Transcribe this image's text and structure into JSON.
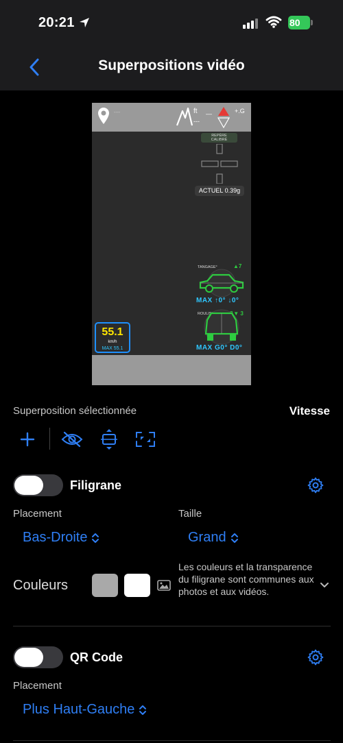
{
  "status_bar": {
    "time": "20:21",
    "battery": "80"
  },
  "nav": {
    "title": "Superpositions vidéo"
  },
  "preview": {
    "calibrated_label_line1": "REPÈRE",
    "calibrated_label_line2": "CALIBRÉ",
    "current_g": "ACTUEL 0.39g",
    "altitude_unit": "ft",
    "altitude_value": "---",
    "heading_value": "—",
    "g_label": "+.G",
    "location_text": "----",
    "pitch_label": "TANGAGE°",
    "pitch_value": "▲7",
    "pitch_max": "MAX ↑0° ↓0°",
    "roll_label": "ROULIS°",
    "roll_value": "G▼ 3",
    "roll_max": "MAX G0° D0°",
    "speed_value": "55.1",
    "speed_unit": "km/h",
    "speed_max": "MAX 55.1"
  },
  "selection": {
    "label": "Superposition sélectionnée",
    "value": "Vitesse"
  },
  "toolbar": {
    "icons": [
      "plus-icon",
      "eye-slash-icon",
      "vertical-center-icon",
      "resize-icon"
    ]
  },
  "watermark": {
    "title": "Filigrane",
    "enabled": false,
    "placement_label": "Placement",
    "placement_value": "Bas-Droite",
    "size_label": "Taille",
    "size_value": "Grand",
    "colors_label": "Couleurs",
    "swatches": [
      "#a9a9a9",
      "#ffffff"
    ],
    "colors_note": "Les couleurs et la transparence du filigrane sont communes aux photos et aux vidéos."
  },
  "qr": {
    "title": "QR Code",
    "enabled": false,
    "placement_label": "Placement",
    "placement_value": "Plus Haut-Gauche"
  },
  "colors": {
    "accent": "#2f7ff5",
    "speed_yellow": "#ffe600",
    "gauge_green": "#2ecc40",
    "max_cyan": "#2fc7ff"
  }
}
